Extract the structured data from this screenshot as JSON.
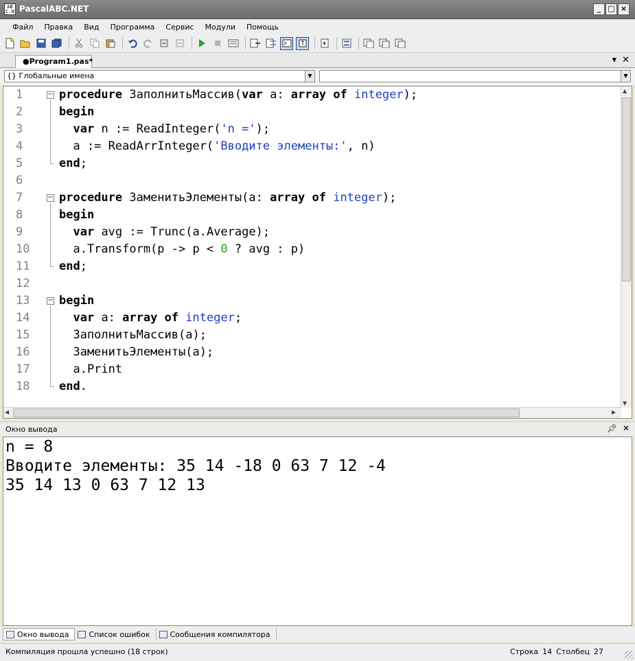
{
  "window": {
    "title": "PascalABC.NET",
    "icon_text": "AB\nC.N",
    "controls": [
      "_",
      "□",
      "×"
    ]
  },
  "menu": [
    "Файл",
    "Правка",
    "Вид",
    "Программа",
    "Сервис",
    "Модули",
    "Помощь"
  ],
  "tab": {
    "label": "●Program1.pas*"
  },
  "combo": {
    "left_value": "{} Глобальные имена",
    "right_value": ""
  },
  "editor": {
    "lines": [
      {
        "n": "1"
      },
      {
        "n": "2"
      },
      {
        "n": "3"
      },
      {
        "n": "4"
      },
      {
        "n": "5"
      },
      {
        "n": "6"
      },
      {
        "n": "7"
      },
      {
        "n": "8"
      },
      {
        "n": "9"
      },
      {
        "n": "10"
      },
      {
        "n": "11"
      },
      {
        "n": "12"
      },
      {
        "n": "13"
      },
      {
        "n": "14"
      },
      {
        "n": "15"
      },
      {
        "n": "16"
      },
      {
        "n": "17"
      },
      {
        "n": "18"
      }
    ],
    "code": [
      [
        [
          "kw",
          "procedure"
        ],
        [
          "t",
          " ЗаполнитьМассив("
        ],
        [
          "kw",
          "var"
        ],
        [
          "t",
          " a: "
        ],
        [
          "kw",
          "array of"
        ],
        [
          "t",
          " "
        ],
        [
          "ty",
          "integer"
        ],
        [
          "t",
          ");"
        ]
      ],
      [
        [
          "kw",
          "begin"
        ]
      ],
      [
        [
          "t",
          "  "
        ],
        [
          "kw",
          "var"
        ],
        [
          "t",
          " n := ReadInteger("
        ],
        [
          "st",
          "'n ='"
        ],
        [
          "t",
          ");"
        ]
      ],
      [
        [
          "t",
          "  a := ReadArrInteger("
        ],
        [
          "st",
          "'Вводите элементы:'"
        ],
        [
          "t",
          ", n)"
        ]
      ],
      [
        [
          "kw",
          "end"
        ],
        [
          "t",
          ";"
        ]
      ],
      [],
      [
        [
          "kw",
          "procedure"
        ],
        [
          "t",
          " ЗаменитьЭлементы(a: "
        ],
        [
          "kw",
          "array of"
        ],
        [
          "t",
          " "
        ],
        [
          "ty",
          "integer"
        ],
        [
          "t",
          ");"
        ]
      ],
      [
        [
          "kw",
          "begin"
        ]
      ],
      [
        [
          "t",
          "  "
        ],
        [
          "kw",
          "var"
        ],
        [
          "t",
          " avg := Trunc(a.Average);"
        ]
      ],
      [
        [
          "t",
          "  a.Transform(p -> p < "
        ],
        [
          "nm",
          "0"
        ],
        [
          "t",
          " ? avg : p)"
        ]
      ],
      [
        [
          "kw",
          "end"
        ],
        [
          "t",
          ";"
        ]
      ],
      [],
      [
        [
          "kw",
          "begin"
        ]
      ],
      [
        [
          "t",
          "  "
        ],
        [
          "kw",
          "var"
        ],
        [
          "t",
          " a: "
        ],
        [
          "kw",
          "array of"
        ],
        [
          "t",
          " "
        ],
        [
          "ty",
          "integer"
        ],
        [
          "t",
          ";"
        ]
      ],
      [
        [
          "t",
          "  ЗаполнитьМассив(a);"
        ]
      ],
      [
        [
          "t",
          "  ЗаменитьЭлементы(a);"
        ]
      ],
      [
        [
          "t",
          "  a.Print"
        ]
      ],
      [
        [
          "kw",
          "end"
        ],
        [
          "t",
          "."
        ]
      ]
    ]
  },
  "output_panel": {
    "title": "Окно вывода",
    "lines": [
      "n = 8",
      "Вводите элементы: 35 14 -18 0 63 7 12 -4",
      "35 14 13 0 63 7 12 13"
    ]
  },
  "bottom_tabs": [
    "Окно вывода",
    "Список ошибок",
    "Сообщения компилятора"
  ],
  "status": {
    "message": "Компиляция прошла успешно (18 строк)",
    "row_label": "Строка",
    "row_value": "14",
    "col_label": "Столбец",
    "col_value": "27"
  },
  "colors": {
    "keyword": "#000000",
    "type": "#1f3fbf",
    "string": "#1f3fbf",
    "number": "#2c9b2c",
    "line_number": "#808080"
  }
}
